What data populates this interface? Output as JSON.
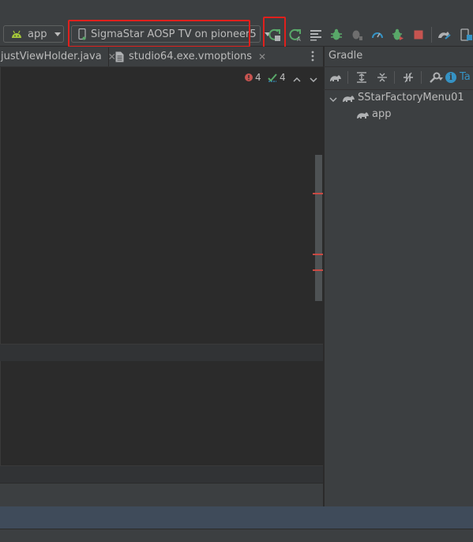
{
  "toolbar": {
    "module_selector": "app",
    "device_selector": "SigmaStar AOSP TV on pioneer5"
  },
  "tabs": [
    {
      "label": "justViewHolder.java"
    },
    {
      "label": "studio64.exe.vmoptions"
    }
  ],
  "editor": {
    "error_count": "4",
    "warning_count": "4"
  },
  "gradle": {
    "title": "Gradle",
    "info_truncated": "Ta",
    "tree": [
      {
        "label": "SStarFactoryMenu01"
      },
      {
        "label": "app"
      }
    ]
  },
  "colors": {
    "highlight_box": "#e0201c",
    "run_green": "#59a869",
    "stop_red": "#c75450",
    "android_green": "#a4c639",
    "info_blue": "#3592c4"
  }
}
